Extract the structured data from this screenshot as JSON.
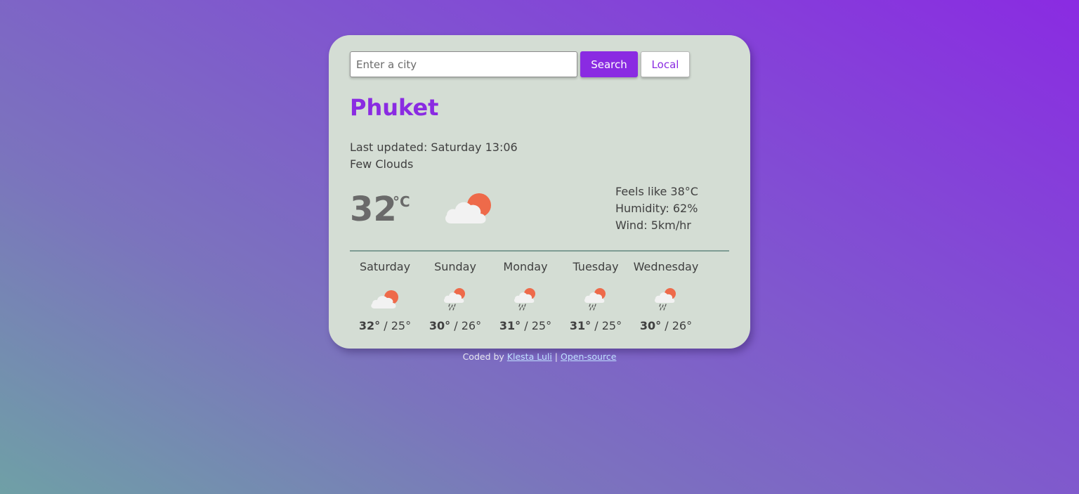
{
  "search": {
    "placeholder": "Enter a city",
    "value": "",
    "search_label": "Search",
    "local_label": "Local"
  },
  "current": {
    "city": "Phuket",
    "last_updated": "Last updated: Saturday 13:06",
    "description": "Few Clouds",
    "temperature": "32",
    "unit": "°C",
    "icon": "few-clouds-icon",
    "feels_like": "Feels like 38°C",
    "humidity": "Humidity: 62%",
    "wind": "Wind: 5km/hr"
  },
  "forecast": [
    {
      "day": "Saturday",
      "max": "32°",
      "min": " / 25°",
      "icon": "few-clouds-icon"
    },
    {
      "day": "Sunday",
      "max": "30°",
      "min": " / 26°",
      "icon": "rain-icon"
    },
    {
      "day": "Monday",
      "max": "31°",
      "min": " / 25°",
      "icon": "rain-icon"
    },
    {
      "day": "Tuesday",
      "max": "31°",
      "min": " / 25°",
      "icon": "rain-icon"
    },
    {
      "day": "Wednesday",
      "max": "30°",
      "min": " / 26°",
      "icon": "rain-icon"
    }
  ],
  "footer": {
    "prefix": "Coded by ",
    "author": "Klesta Luli",
    "separator": " | ",
    "source": "Open-source"
  },
  "colors": {
    "accent": "#8a2be2",
    "card": "#d4ddd4",
    "sun": "#ee6a4a",
    "cloud": "#f2f2f2"
  }
}
